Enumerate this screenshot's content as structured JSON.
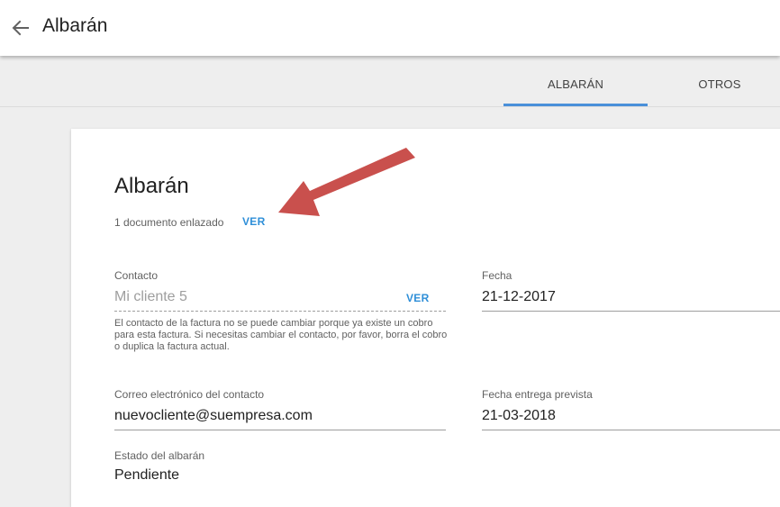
{
  "header": {
    "title": "Albarán",
    "back_icon": "arrow-left-icon"
  },
  "tabs": [
    {
      "label": "ALBARÁN",
      "active": true
    },
    {
      "label": "OTROS",
      "active": false
    }
  ],
  "colors": {
    "accent": "#4a90d9",
    "link": "#2f8fd8",
    "arrow": "#c9504d"
  },
  "card": {
    "title": "Albarán",
    "linked_documents": "1 documento enlazado",
    "linked_view": "VER",
    "contact": {
      "label": "Contacto",
      "value": "Mi cliente 5",
      "view": "VER",
      "helper": "El contacto de la factura no se puede cambiar porque ya existe un cobro para esta factura. Si necesitas cambiar el contacto, por favor, borra el cobro o duplica la factura actual."
    },
    "fecha": {
      "label": "Fecha",
      "value": "21-12-2017"
    },
    "email": {
      "label": "Correo electrónico del contacto",
      "value": "nuevocliente@suempresa.com"
    },
    "fecha_entrega": {
      "label": "Fecha entrega prevista",
      "value": "21-03-2018"
    },
    "estado": {
      "label": "Estado del albarán",
      "value": "Pendiente"
    }
  }
}
